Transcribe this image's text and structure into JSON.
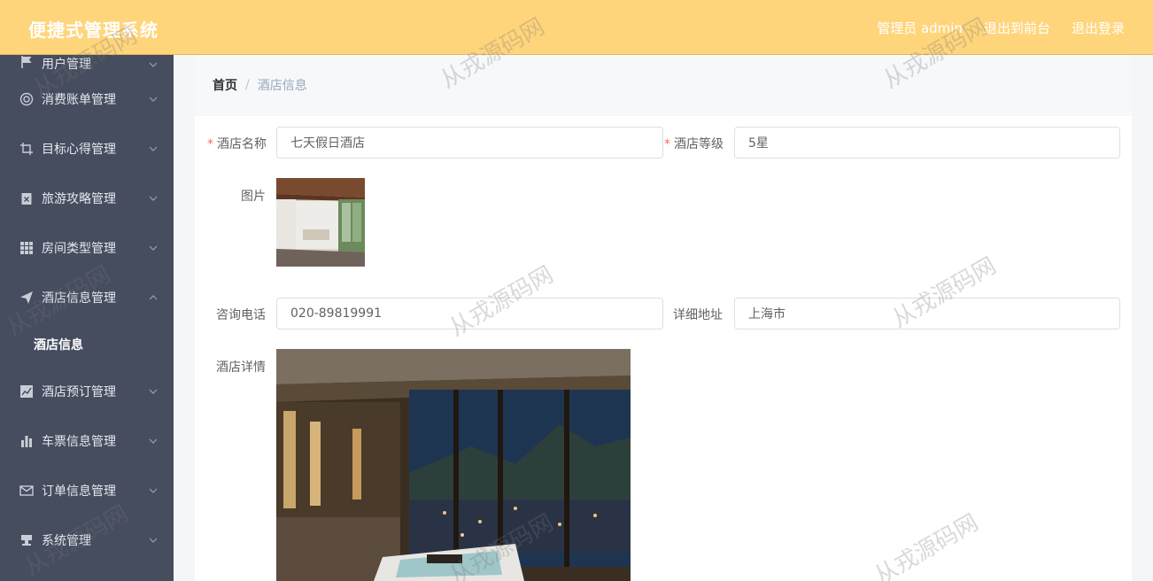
{
  "header": {
    "app_title": "便捷式管理系统",
    "user_label": "管理员 admin",
    "frontend_link": "退出到前台",
    "logout_link": "退出登录"
  },
  "sidebar": {
    "items": [
      {
        "label": "用户管理",
        "icon": "flag-icon"
      },
      {
        "label": "消费账单管理",
        "icon": "lifebuoy-icon"
      },
      {
        "label": "目标心得管理",
        "icon": "crop-icon"
      },
      {
        "label": "旅游攻略管理",
        "icon": "clipboard-x-icon"
      },
      {
        "label": "房间类型管理",
        "icon": "grid-icon"
      },
      {
        "label": "酒店信息管理",
        "icon": "send-icon",
        "expanded": true
      },
      {
        "label": "酒店预订管理",
        "icon": "line-chart-icon"
      },
      {
        "label": "车票信息管理",
        "icon": "bar-chart-icon"
      },
      {
        "label": "订单信息管理",
        "icon": "mail-icon"
      },
      {
        "label": "系统管理",
        "icon": "stamp-icon"
      }
    ],
    "submenu_active": "酒店信息"
  },
  "breadcrumb": {
    "home": "首页",
    "separator": "/",
    "current": "酒店信息"
  },
  "form": {
    "hotel_name_label": "酒店名称",
    "hotel_name_value": "七天假日酒店",
    "hotel_level_label": "酒店等级",
    "hotel_level_value": "5星",
    "image_label": "图片",
    "phone_label": "咨询电话",
    "phone_value": "020-89819991",
    "address_label": "详细地址",
    "address_value": "上海市",
    "detail_label": "酒店详情",
    "required_mark": "*"
  },
  "watermark_text": "从戎源码网",
  "colors": {
    "header_bg": "#ffd57c",
    "sidebar_bg": "#454d5f",
    "required": "#f56c6c",
    "breadcrumb_current": "#97a8be"
  }
}
